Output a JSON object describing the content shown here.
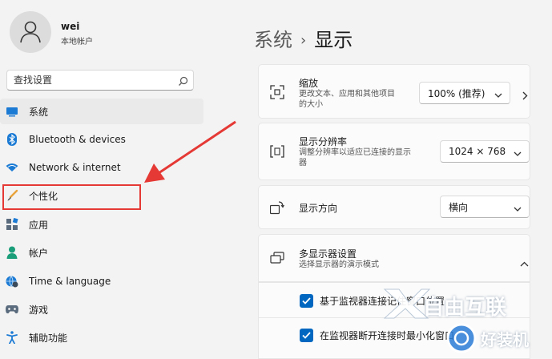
{
  "user": {
    "name": "wei",
    "account_type": "本地帐户"
  },
  "search": {
    "placeholder": "查找设置"
  },
  "sidebar": {
    "items": [
      {
        "label": "系统",
        "icon": "monitor-icon"
      },
      {
        "label": "Bluetooth & devices",
        "icon": "bluetooth-icon"
      },
      {
        "label": "Network & internet",
        "icon": "wifi-icon"
      },
      {
        "label": "个性化",
        "icon": "paintbrush-icon"
      },
      {
        "label": "应用",
        "icon": "apps-icon"
      },
      {
        "label": "帐户",
        "icon": "person-icon"
      },
      {
        "label": "Time & language",
        "icon": "globe-clock-icon"
      },
      {
        "label": "游戏",
        "icon": "gamepad-icon"
      },
      {
        "label": "辅助功能",
        "icon": "accessibility-icon"
      }
    ]
  },
  "breadcrumb": {
    "parent": "系统",
    "separator": "›",
    "current": "显示"
  },
  "settings": {
    "scale": {
      "title": "缩放",
      "subtitle_line1": "更改文本、应用和其他项目",
      "subtitle_line2": "的大小",
      "value": "100% (推荐)"
    },
    "resolution": {
      "title": "显示分辨率",
      "subtitle_line1": "调整分辨率以适应已连接的显示",
      "subtitle_line2": "器",
      "value": "1024 × 768"
    },
    "orientation": {
      "title": "显示方向",
      "value": "横向"
    },
    "multi_display": {
      "title": "多显示器设置",
      "subtitle": "选择显示器的演示模式",
      "options": [
        {
          "label": "基于监视器连接记住窗口位置",
          "checked": true
        },
        {
          "label": "在监视器断开连接时最小化窗口",
          "checked": true
        }
      ]
    }
  },
  "watermarks": {
    "brand1": "自由互联",
    "brand2": "好装机"
  },
  "colors": {
    "accent": "#0067c0",
    "highlight": "#e53935"
  }
}
